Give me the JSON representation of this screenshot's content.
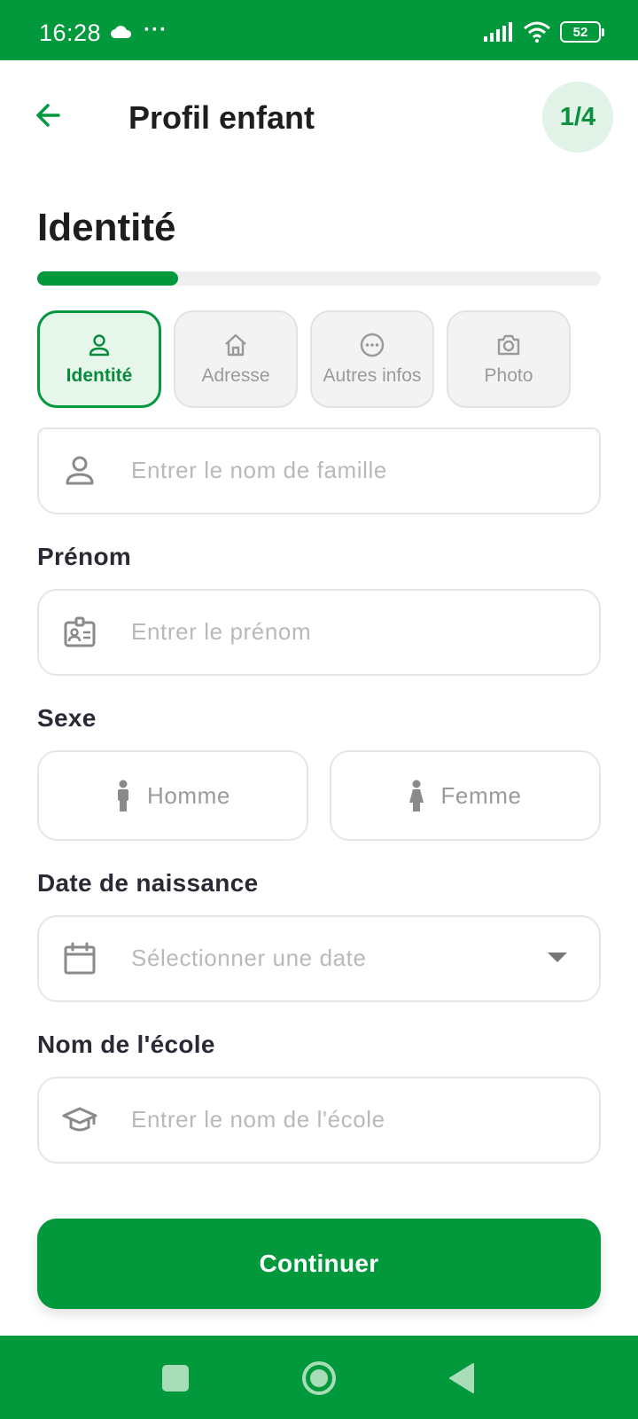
{
  "status_bar": {
    "time": "16:28",
    "more": "···",
    "battery": "52"
  },
  "header": {
    "title": "Profil enfant",
    "step": "1/4"
  },
  "section": {
    "title": "Identité",
    "progress": 0.25
  },
  "tabs": [
    {
      "label": "Identité",
      "icon": "user-icon",
      "active": true
    },
    {
      "label": "Adresse",
      "icon": "home-icon",
      "active": false
    },
    {
      "label": "Autres infos",
      "icon": "more-circle-icon",
      "active": false
    },
    {
      "label": "Photo",
      "icon": "camera-icon",
      "active": false
    }
  ],
  "form": {
    "last_name": {
      "placeholder": "Entrer le nom de famille"
    },
    "first_name": {
      "label": "Prénom",
      "placeholder": "Entrer le prénom"
    },
    "gender": {
      "label": "Sexe",
      "male": "Homme",
      "female": "Femme"
    },
    "birth_date": {
      "label": "Date de naissance",
      "placeholder": "Sélectionner une date"
    },
    "school": {
      "label": "Nom de l'école",
      "placeholder": "Entrer le nom de l'école"
    }
  },
  "actions": {
    "continue": "Continuer"
  },
  "colors": {
    "primary": "#02993c",
    "badge_bg": "#e1f3e6",
    "placeholder": "#b9b9b9"
  }
}
